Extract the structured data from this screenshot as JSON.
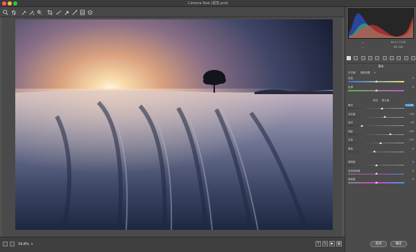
{
  "window": {
    "title": "Camera Raw (视觉.psd)"
  },
  "toolbar": {
    "tools": [
      "zoom-icon",
      "hand-icon",
      "white-balance-icon",
      "color-sampler-icon",
      "target-adjust-icon",
      "crop-icon",
      "straighten-icon",
      "spot-removal-icon",
      "red-eye-icon",
      "adjustment-brush-icon",
      "graduated-filter-icon",
      "radial-filter-icon"
    ],
    "right_tool": "open-preferences-icon"
  },
  "canvas": {
    "zoom": "34.8%"
  },
  "histogram": {
    "bins_r": [
      2,
      3,
      4,
      6,
      9,
      12,
      14,
      15,
      16,
      17,
      18,
      18,
      17,
      16,
      14,
      12,
      10,
      8,
      6,
      4,
      3,
      2,
      2,
      3,
      4,
      6,
      9,
      14,
      22,
      30
    ],
    "bins_g": [
      3,
      4,
      6,
      10,
      14,
      17,
      19,
      20,
      19,
      17,
      15,
      12,
      10,
      8,
      7,
      6,
      5,
      4,
      3,
      3,
      2,
      2,
      2,
      2,
      3,
      4,
      6,
      10,
      16,
      24
    ],
    "bins_b": [
      6,
      12,
      22,
      30,
      34,
      33,
      29,
      25,
      21,
      17,
      14,
      11,
      9,
      7,
      6,
      5,
      4,
      3,
      3,
      2,
      2,
      2,
      2,
      2,
      2,
      3,
      4,
      6,
      9,
      12
    ]
  },
  "camera_info": {
    "left": [
      "---",
      "---"
    ],
    "right": [
      "f/4.0 / 1/125",
      "ISO 200"
    ]
  },
  "panel": {
    "section": "基本",
    "white_balance_label": "白平衡:",
    "white_balance_value": "原照设置",
    "auto_label": "自动",
    "default_label": "默认值",
    "controls_wb": [
      {
        "label": "色温",
        "value": "0",
        "track": "temp",
        "pos": 0.5
      },
      {
        "label": "色调",
        "value": "0",
        "track": "tint",
        "pos": 0.5
      }
    ],
    "controls_tone": [
      {
        "label": "曝光",
        "value": "+0.80",
        "boxed": true,
        "pos": 0.6
      },
      {
        "label": "对比度",
        "value": "+30",
        "pos": 0.65
      },
      {
        "label": "高光",
        "value": "-50",
        "pos": 0.25
      },
      {
        "label": "阴影",
        "value": "+50",
        "pos": 0.75
      },
      {
        "label": "白色",
        "value": "+15",
        "pos": 0.58
      },
      {
        "label": "黑色",
        "value": "-5",
        "pos": 0.47
      }
    ],
    "controls_presence": [
      {
        "label": "清晰度",
        "value": "0",
        "pos": 0.5
      },
      {
        "label": "自然饱和度",
        "value": "0",
        "track": "sat",
        "pos": 0.5
      },
      {
        "label": "饱和度",
        "value": "0",
        "track": "sat",
        "pos": 0.5
      }
    ]
  },
  "footer": {
    "cancel": "取消",
    "ok": "确定"
  },
  "colors": {
    "accent": "#3f8ad8"
  }
}
